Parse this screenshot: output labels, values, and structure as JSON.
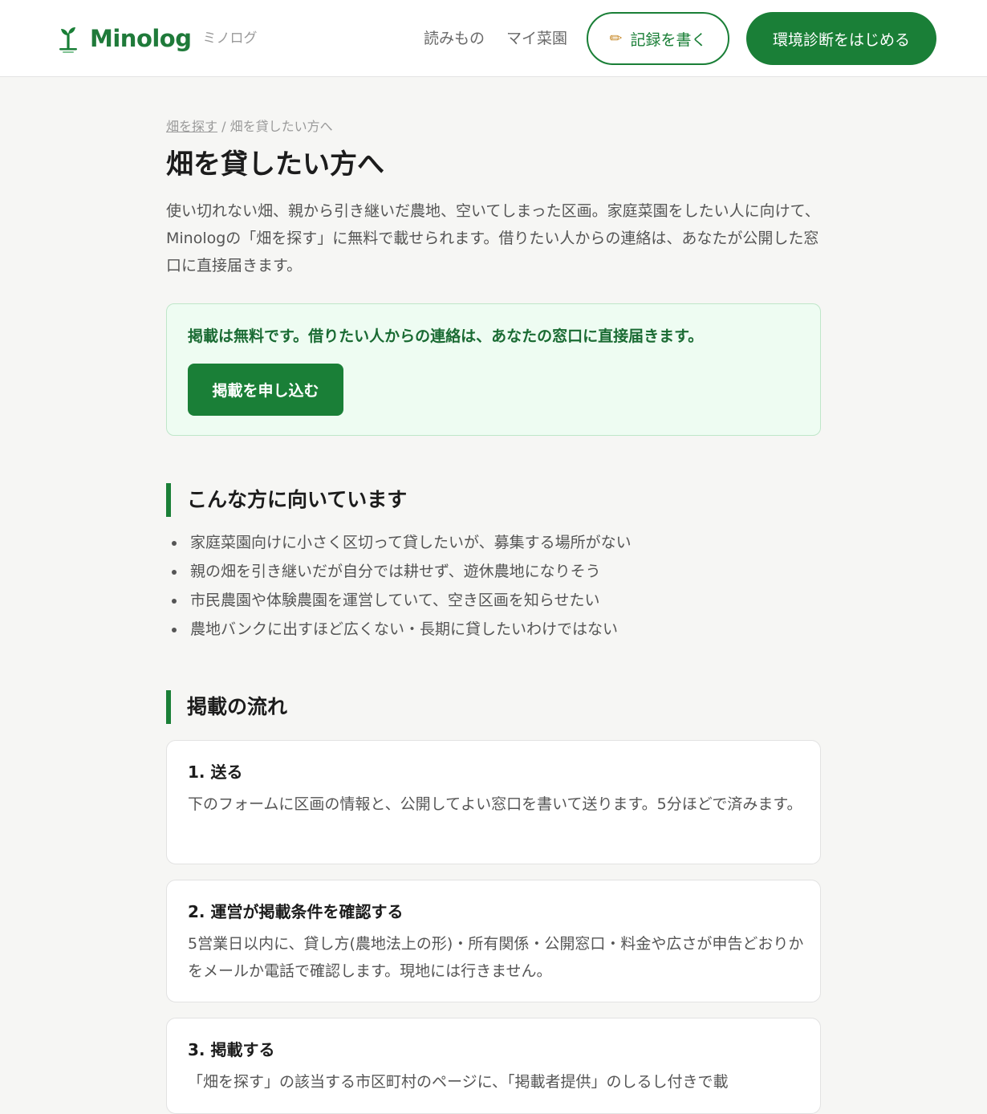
{
  "header": {
    "logo_text": "Minolog",
    "logo_sub": "ミノログ",
    "nav": [
      "読みもの",
      "マイ菜園"
    ],
    "write_label": "記録を書く",
    "start_label": "環境診断をはじめる",
    "colors": {
      "brand": "#1a7f37",
      "brand_text": "#1f7a3a"
    }
  },
  "breadcrumb": {
    "parent": "畑を探す",
    "separator": "/",
    "current": "畑を貸したい方へ"
  },
  "page_title": "畑を貸したい方へ",
  "lead": "使い切れない畑、親から引き継いだ農地、空いてしまった区画。家庭菜園をしたい人に向けて、Minologの「畑を探す」に無料で載せられます。借りたい人からの連絡は、あなたが公開した窓口に直接届きます。",
  "notice": {
    "text": "掲載は無料です。借りたい人からの連絡は、あなたの窓口に直接届きます。",
    "button_label": "掲載を申し込む"
  },
  "fit_section": {
    "heading": "こんな方に向いています",
    "items": [
      "家庭菜園向けに小さく区切って貸したいが、募集する場所がない",
      "親の畑を引き継いだが自分では耕せず、遊休農地になりそう",
      "市民農園や体験農園を運営していて、空き区画を知らせたい",
      "農地バンクに出すほど広くない・長期に貸したいわけではない"
    ]
  },
  "flow_section": {
    "heading": "掲載の流れ",
    "steps": [
      {
        "title": "1. 送る",
        "body": "下のフォームに区画の情報と、公開してよい窓口を書いて送ります。5分ほどで済みます。"
      },
      {
        "title": "2. 運営が掲載条件を確認する",
        "body": "5営業日以内に、貸し方(農地法上の形)・所有関係・公開窓口・料金や広さが申告どおりかをメールか電話で確認します。現地には行きません。"
      },
      {
        "title": "3. 掲載する",
        "body": "「畑を探す」の該当する市区町村のページに、「掲載者提供」のしるし付きで載"
      }
    ]
  }
}
